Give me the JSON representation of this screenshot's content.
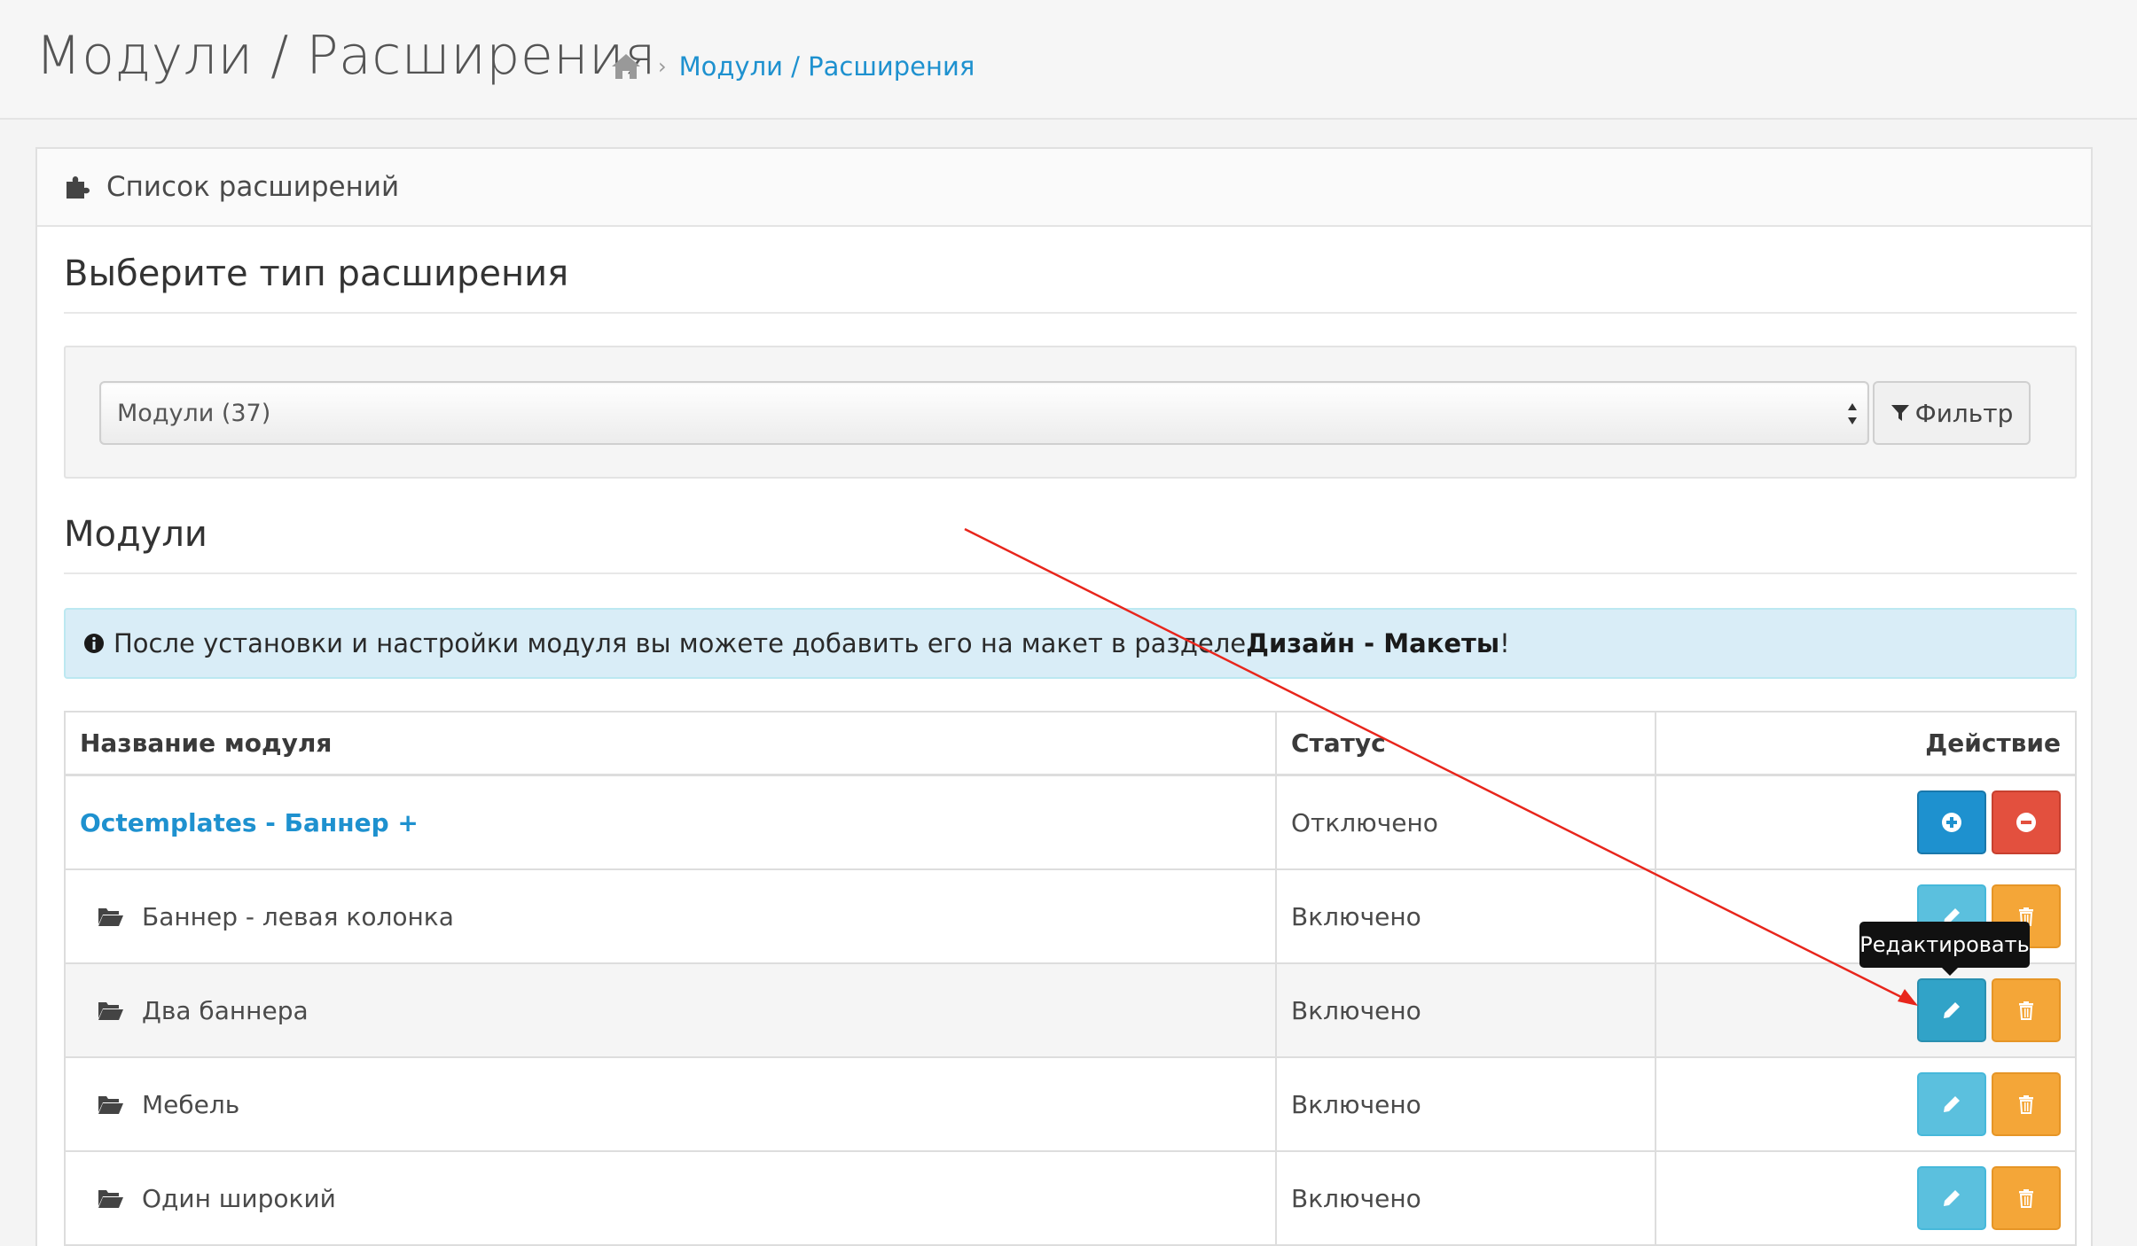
{
  "header": {
    "title": "Модули / Расширения",
    "breadcrumb": [
      "Модули / Расширения"
    ]
  },
  "panel": {
    "heading": "Список расширений",
    "choose_title": "Выберите тип расширения",
    "select_value": "Модули (37)",
    "filter_label": "Фильтр",
    "modules_title": "Модули",
    "alert_text": "После установки и настройки модуля вы можете добавить его на макет в разделе ",
    "alert_strong": "Дизайн - Макеты",
    "alert_end": "!"
  },
  "table": {
    "columns": [
      "Название модуля",
      "Статус",
      "Действие"
    ],
    "rows": [
      {
        "name": "Octemplates - Баннер +",
        "status": "Отключено",
        "type": "parent"
      },
      {
        "name": "Баннер - левая колонка",
        "status": "Включено",
        "type": "child"
      },
      {
        "name": "Два баннера",
        "status": "Включено",
        "type": "child"
      },
      {
        "name": "Мебель",
        "status": "Включено",
        "type": "child"
      },
      {
        "name": "Один широкий",
        "status": "Включено",
        "type": "child"
      }
    ]
  },
  "tooltip": "Редактировать",
  "colors": {
    "link": "#1e91cf",
    "install": "#1e91cf",
    "uninstall": "#e3503e",
    "edit": "#5bc0de",
    "delete": "#f4a638",
    "alert_bg": "#d9edf7",
    "annotation_arrow": "#e8261c"
  },
  "icons": {
    "breadcrumb_home": "home-icon",
    "panel_heading": "puzzle-icon",
    "filter": "filter-icon",
    "alert": "info-icon",
    "row": "folder-open-icon",
    "install": "plus-circle-icon",
    "uninstall": "minus-circle-icon",
    "edit": "pencil-icon",
    "delete": "trash-icon"
  }
}
